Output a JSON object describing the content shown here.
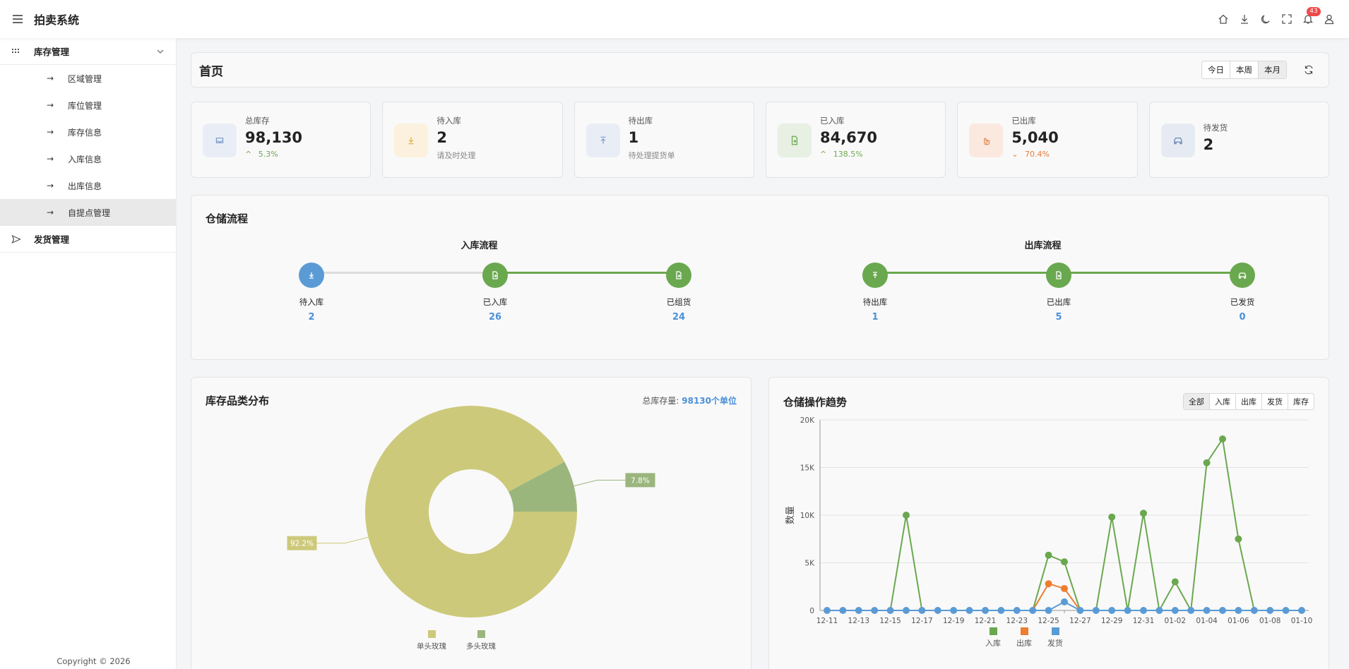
{
  "app": {
    "title": "拍卖系统",
    "notification_count": "43"
  },
  "sidebar": {
    "groups": [
      {
        "label": "库存管理",
        "items": [
          "区域管理",
          "库位管理",
          "库存信息",
          "入库信息",
          "出库信息",
          "自提点管理"
        ]
      },
      {
        "label": "发货管理"
      }
    ],
    "active_item": "自提点管理",
    "copyright": "Copyright © 2026"
  },
  "page": {
    "title": "首页",
    "range_tabs": [
      "今日",
      "本周",
      "本月"
    ],
    "active_range": "本月"
  },
  "stats": [
    {
      "label": "总库存",
      "value": "98,130",
      "sub": "5.3%",
      "trend": "up",
      "icon": "inbox-icon",
      "color": "#e9eef6"
    },
    {
      "label": "待入库",
      "value": "2",
      "sub": "请及时处理",
      "trend": "none",
      "icon": "download-icon",
      "color": "#fbf1de"
    },
    {
      "label": "待出库",
      "value": "1",
      "sub": "待处理提货单",
      "trend": "none",
      "icon": "upload-icon",
      "color": "#e9eef6"
    },
    {
      "label": "已入库",
      "value": "84,670",
      "sub": "138.5%",
      "trend": "up",
      "icon": "file-in-icon",
      "color": "#e7f0e3"
    },
    {
      "label": "已出库",
      "value": "5,040",
      "sub": "70.4%",
      "trend": "down",
      "icon": "hand-icon",
      "color": "#fbe9e0"
    },
    {
      "label": "待发货",
      "value": "2",
      "sub": "",
      "trend": "none",
      "icon": "car-icon",
      "color": "#e6ebf3"
    }
  ],
  "flow": {
    "title": "仓储流程",
    "inbound": {
      "title": "入库流程",
      "steps": [
        {
          "label": "待入库",
          "value": "2"
        },
        {
          "label": "已入库",
          "value": "26"
        },
        {
          "label": "已组货",
          "value": "24"
        }
      ]
    },
    "outbound": {
      "title": "出库流程",
      "steps": [
        {
          "label": "待出库",
          "value": "1"
        },
        {
          "label": "已出库",
          "value": "5"
        },
        {
          "label": "已发货",
          "value": "0"
        }
      ]
    },
    "colors": {
      "blue": "#5b9bd5",
      "green": "#6aa84f",
      "gray": "#dcdcdc"
    }
  },
  "pie_card": {
    "title": "库存品类分布",
    "meta_label": "总库存量:",
    "meta_value": "98130个单位"
  },
  "trend_card": {
    "title": "仓储操作趋势",
    "tabs": [
      "全部",
      "入库",
      "出库",
      "发货",
      "库存"
    ],
    "active_tab": "全部"
  },
  "chart_data": [
    {
      "type": "pie",
      "labels": [
        "单头玫瑰",
        "多头玫瑰"
      ],
      "values": [
        92.2,
        7.8
      ],
      "data_labels": [
        "92.2%",
        "7.8%"
      ],
      "colors": [
        "#cdc97b",
        "#9bb67d"
      ],
      "donut": true,
      "legend": "bottom"
    },
    {
      "type": "line",
      "x": [
        "12-11",
        "12-12",
        "12-13",
        "12-14",
        "12-15",
        "12-16",
        "12-17",
        "12-18",
        "12-19",
        "12-20",
        "12-21",
        "12-22",
        "12-23",
        "12-24",
        "12-25",
        "12-26",
        "12-27",
        "12-28",
        "12-29",
        "12-30",
        "12-31",
        "01-01",
        "01-02",
        "01-03",
        "01-04",
        "01-05",
        "01-06",
        "01-07",
        "01-08",
        "01-09",
        "01-10"
      ],
      "x_tick_labels": [
        "12-11",
        "12-13",
        "12-15",
        "12-17",
        "12-19",
        "12-21",
        "12-23",
        "12-25",
        "12-27",
        "12-29",
        "12-31",
        "01-02",
        "01-04",
        "01-06",
        "01-08",
        "01-10"
      ],
      "ylabel": "数量",
      "ylim": [
        0,
        20000
      ],
      "y_ticks": [
        "0",
        "5K",
        "10K",
        "15K",
        "20K"
      ],
      "grid": true,
      "legend": "bottom",
      "series": [
        {
          "name": "入库",
          "color": "#6aa84f",
          "values": [
            0,
            0,
            0,
            0,
            0,
            10000,
            0,
            0,
            0,
            0,
            0,
            0,
            0,
            0,
            5800,
            5100,
            0,
            0,
            9800,
            0,
            10200,
            0,
            3000,
            0,
            15500,
            18000,
            7500,
            0,
            0,
            0,
            0
          ]
        },
        {
          "name": "出库",
          "color": "#ed7d31",
          "values": [
            0,
            0,
            0,
            0,
            0,
            0,
            0,
            0,
            0,
            0,
            0,
            0,
            0,
            0,
            2800,
            2300,
            0,
            0,
            0,
            0,
            0,
            0,
            0,
            0,
            0,
            0,
            0,
            0,
            0,
            0,
            0
          ]
        },
        {
          "name": "发货",
          "color": "#5b9bd5",
          "values": [
            0,
            0,
            0,
            0,
            0,
            0,
            0,
            0,
            0,
            0,
            0,
            0,
            0,
            0,
            0,
            900,
            0,
            0,
            0,
            0,
            0,
            0,
            0,
            0,
            0,
            0,
            0,
            0,
            0,
            0,
            0
          ]
        }
      ]
    }
  ]
}
